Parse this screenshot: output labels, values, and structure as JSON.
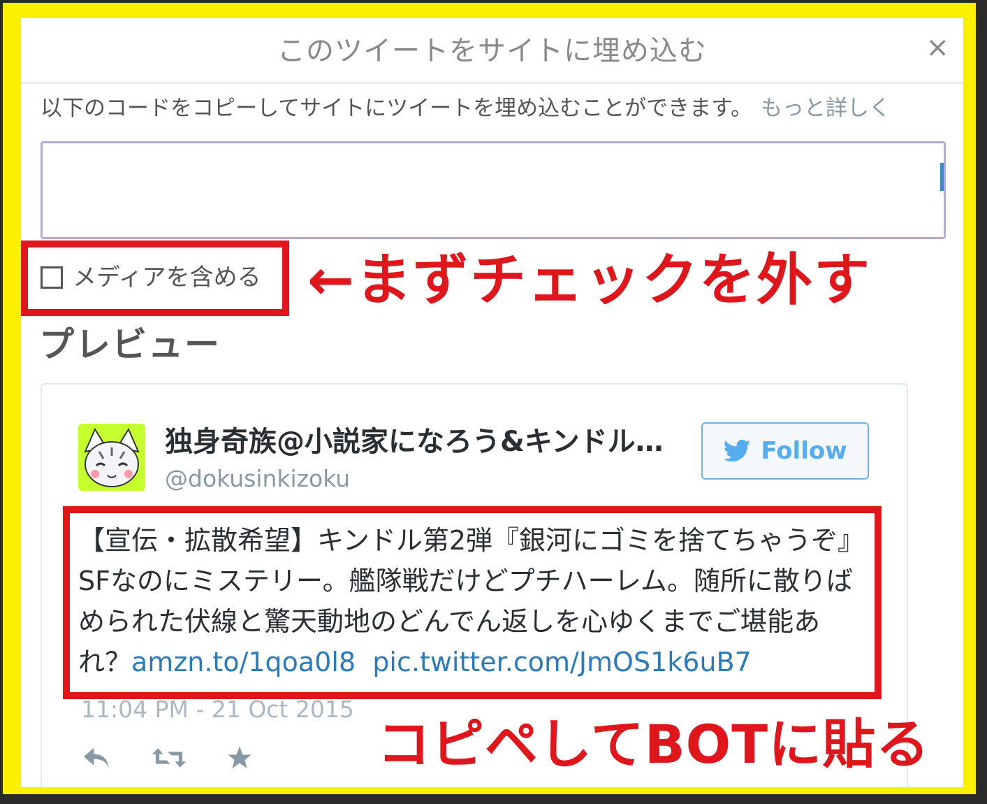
{
  "dialog": {
    "title": "このツイートをサイトに埋め込む",
    "close_label": "×",
    "description": "以下のコードをコピーしてサイトにツイートを埋め込むことができます。",
    "learn_more": "もっと詳しく",
    "code_value": "",
    "include_media_label": "メディアを含める",
    "include_media_checked": false,
    "preview_heading": "プレビュー"
  },
  "tweet": {
    "display_name": "独身奇族@小説家になろう&キンドル…",
    "handle": "@dokusinkizoku",
    "follow_label": "Follow",
    "text": "【宣伝・拡散希望】キンドル第2弾『銀河にゴミを捨てちゃうぞ』SFなのにミステリー。艦隊戦だけどプチハーレム。随所に散りばめられた伏線と驚天動地のどんでん返しを心ゆくまでご堪能あれ？",
    "link1": "amzn.to/1qoa0l8",
    "link2": "pic.twitter.com/JmOS1k6uB7",
    "timestamp": "11:04 PM - 21 Oct 2015"
  },
  "annotations": {
    "checkbox_note": "←まずチェックを外す",
    "copy_note": "コピペしてBOTに貼る"
  },
  "colors": {
    "highlight_yellow": "#fbf000",
    "annotation_red": "#e0161d",
    "twitter_blue": "#55acee",
    "link_blue": "#2b7bb9"
  },
  "icons": [
    "close-icon",
    "checkbox",
    "twitter-bird-icon",
    "reply-icon",
    "retweet-icon",
    "favorite-star-icon"
  ]
}
